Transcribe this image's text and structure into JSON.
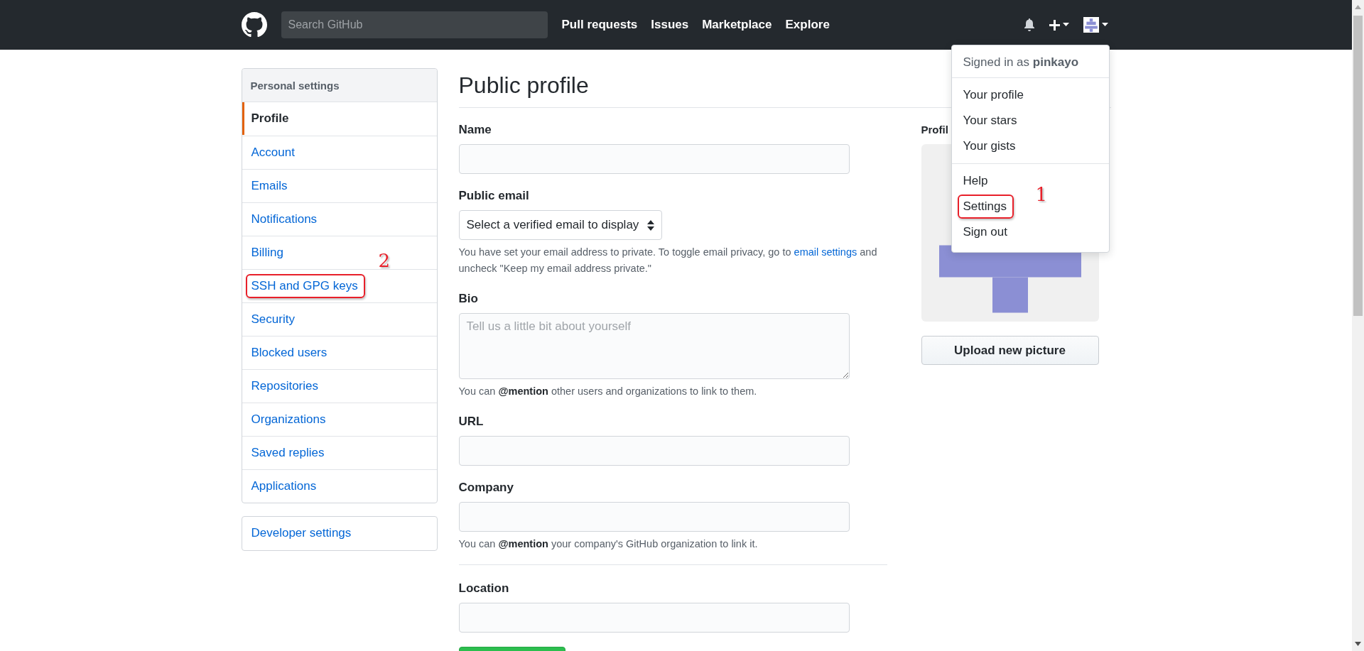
{
  "header": {
    "search": {
      "placeholder": "Search GitHub"
    },
    "nav": [
      "Pull requests",
      "Issues",
      "Marketplace",
      "Explore"
    ]
  },
  "user_menu": {
    "signed_in": "Signed in as **pinkayo**",
    "groups": [
      [
        {
          "label": "Your profile"
        },
        {
          "label": "Your stars"
        },
        {
          "label": "Your gists"
        }
      ],
      [
        {
          "label": "Help"
        },
        {
          "label": "Settings",
          "callout": "1"
        },
        {
          "label": "Sign out"
        }
      ]
    ]
  },
  "sidebar": {
    "heading": "Personal settings",
    "items": [
      {
        "label": "Profile",
        "selected": true
      },
      {
        "label": "Account",
        "selected": false
      },
      {
        "label": "Emails",
        "selected": false
      },
      {
        "label": "Notifications",
        "selected": false
      },
      {
        "label": "Billing",
        "selected": false
      },
      {
        "label": "SSH and GPG keys",
        "selected": false,
        "callout": "2"
      },
      {
        "label": "Security",
        "selected": false
      },
      {
        "label": "Blocked users",
        "selected": false
      },
      {
        "label": "Repositories",
        "selected": false
      },
      {
        "label": "Organizations",
        "selected": false
      },
      {
        "label": "Saved replies",
        "selected": false
      },
      {
        "label": "Applications",
        "selected": false
      }
    ],
    "developer": "Developer settings"
  },
  "page": {
    "title": "Public profile",
    "fields": [
      {
        "kind": "text",
        "label": "Name"
      },
      {
        "kind": "select",
        "label": "Public email",
        "value": "Select a verified email to display",
        "hint": {
          "before": "You have set your email address to private. To toggle email privacy, go to ",
          "link": "email settings",
          "after": " and uncheck \"Keep my email address private.\""
        }
      },
      {
        "kind": "textarea",
        "label": "Bio",
        "placeholder": "Tell us a little bit about yourself",
        "hint": {
          "before": "You can **@mention** other users and organizations to link to them."
        }
      },
      {
        "kind": "text",
        "label": "URL"
      },
      {
        "kind": "text",
        "label": "Company",
        "hint": {
          "before": "You can **@mention** your company's GitHub organization to link it."
        }
      },
      {
        "kind": "text",
        "label": "Location",
        "divider_before": true
      }
    ],
    "picture": {
      "label": "Profil",
      "upload_button": "Upload new picture"
    }
  }
}
